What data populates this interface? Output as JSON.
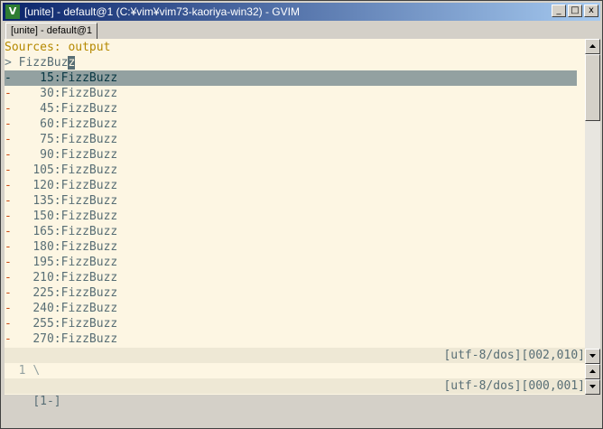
{
  "window": {
    "title": "[unite] - default@1 (C:¥vim¥vim73-kaoriya-win32) - GVIM",
    "icon_label": "V",
    "minimize_symbol": "_",
    "maximize_symbol": "□",
    "close_symbol": "x"
  },
  "tabline": {
    "tabs": [
      {
        "label": "[unite] - default@1"
      }
    ]
  },
  "unite": {
    "sources_label": "Sources: output",
    "prompt_symbol": ">",
    "prompt_text": "FizzBuz",
    "cursor_char": "z",
    "candidate_marker": "-",
    "candidates": [
      "15:FizzBuzz",
      "30:FizzBuzz",
      "45:FizzBuzz",
      "60:FizzBuzz",
      "75:FizzBuzz",
      "90:FizzBuzz",
      "105:FizzBuzz",
      "120:FizzBuzz",
      "135:FizzBuzz",
      "150:FizzBuzz",
      "165:FizzBuzz",
      "180:FizzBuzz",
      "195:FizzBuzz",
      "210:FizzBuzz",
      "225:FizzBuzz",
      "240:FizzBuzz",
      "255:FizzBuzz",
      "270:FizzBuzz"
    ],
    "selected_index": 0
  },
  "statusline_top": {
    "right": "[utf-8/dos][002,010]"
  },
  "lower_window": {
    "line_number": "1",
    "line_content": "\\"
  },
  "statusline_bottom": {
    "left": "[1-]",
    "right": "[utf-8/dos][000,001]"
  },
  "colors": {
    "background": "#fdf6e3",
    "statusline": "#eee8d5",
    "selection": "#93a1a1",
    "accent_yellow": "#b58900",
    "accent_orange": "#cb4b16",
    "titlebar_start": "#0a246a"
  },
  "icons": {
    "app": "vim-icon",
    "minimize": "minimize-icon",
    "maximize": "maximize-icon",
    "close": "close-icon",
    "scroll_up": "arrow-up-icon",
    "scroll_down": "arrow-down-icon"
  }
}
